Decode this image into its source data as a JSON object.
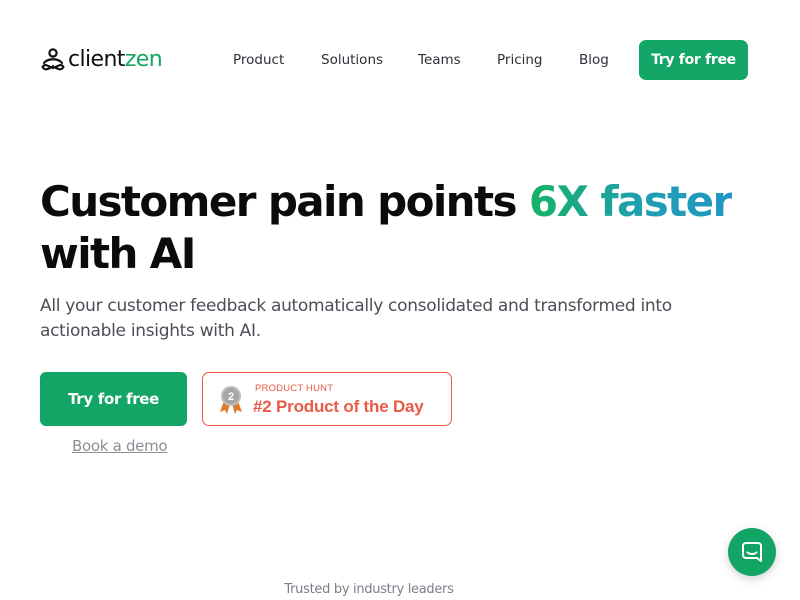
{
  "brand": {
    "name_part1": "client",
    "name_part2": "zen",
    "logo_icon": "meditation-figure-icon",
    "colors": {
      "primary_green": "#12a565",
      "text_dark": "#111111",
      "badge_red": "#ea5a47"
    }
  },
  "nav": {
    "links": [
      "Product",
      "Solutions",
      "Teams",
      "Pricing",
      "Blog"
    ],
    "cta_label": "Try for free"
  },
  "hero": {
    "title_part1": "Customer pain points ",
    "title_highlight": "6X faster",
    "title_part2": "with AI",
    "subtitle": "All your customer feedback automatically consolidated and transformed into actionable insights with AI.",
    "primary_cta": "Try for free",
    "secondary_link": "Book a demo"
  },
  "product_hunt": {
    "label": "PRODUCT HUNT",
    "title": "#2 Product of the Day",
    "medal_number": "2",
    "icon": "medal-icon"
  },
  "trusted_text": "Trusted by industry leaders",
  "chat_widget": {
    "icon": "chat-bubble-icon"
  }
}
